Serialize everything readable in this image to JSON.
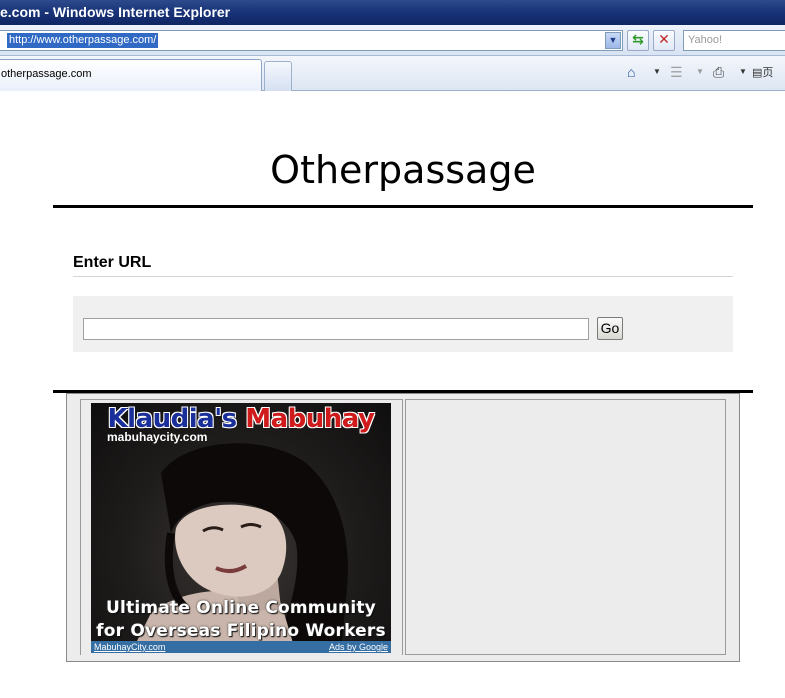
{
  "browser": {
    "window_title": "e.com - Windows Internet Explorer",
    "address_url": "http://www.otherpassage.com/",
    "search_placeholder": "Yahoo!",
    "tab_label": "otherpassage.com",
    "page_menu_label": "页"
  },
  "page": {
    "site_title": "Otherpassage",
    "section_heading": "Enter URL",
    "url_input_value": "",
    "go_button_label": "Go"
  },
  "ad": {
    "headline_part1": "Klaudia's",
    "headline_part2": "Mabuhay",
    "site_text": "mabuhaycity.com",
    "tagline_line1": "Ultimate Online Community",
    "tagline_line2": "for Overseas Filipino Workers",
    "footer_left": "MabuhayCity.com",
    "footer_right": "Ads by Google"
  },
  "icons": {
    "refresh": "refresh-icon",
    "stop": "stop-icon",
    "home": "home-icon",
    "feeds": "feed-icon",
    "print": "print-icon",
    "page": "page-icon"
  },
  "colors": {
    "titlebar": "#1a357a",
    "rule": "#000000",
    "form_bg": "#f0f0f0",
    "ad_footer": "#356ea3"
  }
}
